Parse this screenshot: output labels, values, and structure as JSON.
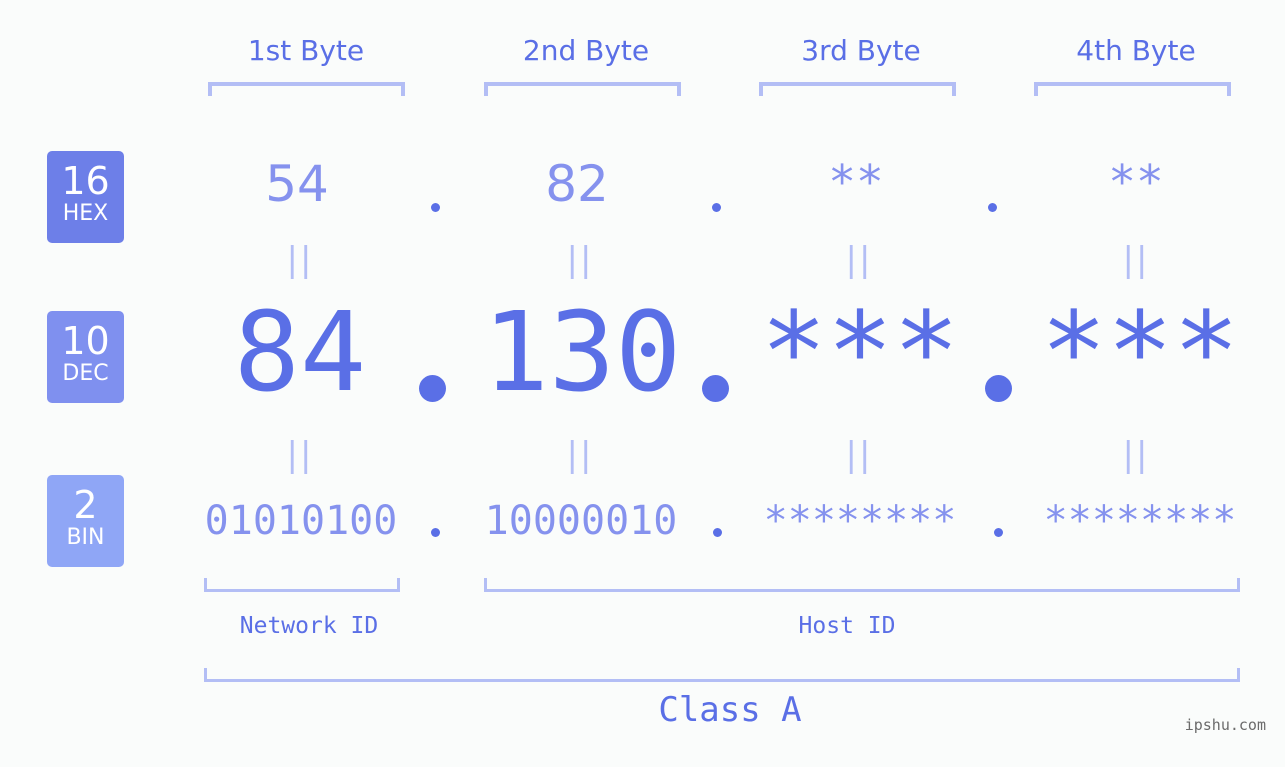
{
  "colors": {
    "accent": "#5a6fe6",
    "light_accent": "#8592ee",
    "bracket": "#b3bef5",
    "hex_badge": "#6d7fe8",
    "dec_badge": "#7f90ef",
    "bin_badge": "#8fa6f6",
    "background": "#fafcfb"
  },
  "byte_headers": [
    "1st Byte",
    "2nd Byte",
    "3rd Byte",
    "4th Byte"
  ],
  "bases": {
    "hex": {
      "number": "16",
      "label": "HEX"
    },
    "dec": {
      "number": "10",
      "label": "DEC"
    },
    "bin": {
      "number": "2",
      "label": "BIN"
    }
  },
  "hex_values": [
    "54",
    "82",
    "**",
    "**"
  ],
  "dec_values": [
    "84",
    "130",
    "***",
    "***"
  ],
  "bin_values": [
    "01010100",
    "10000010",
    "********",
    "********"
  ],
  "equals_symbol": "||",
  "network_id_label": "Network ID",
  "host_id_label": "Host ID",
  "class_label": "Class A",
  "watermark": "ipshu.com"
}
